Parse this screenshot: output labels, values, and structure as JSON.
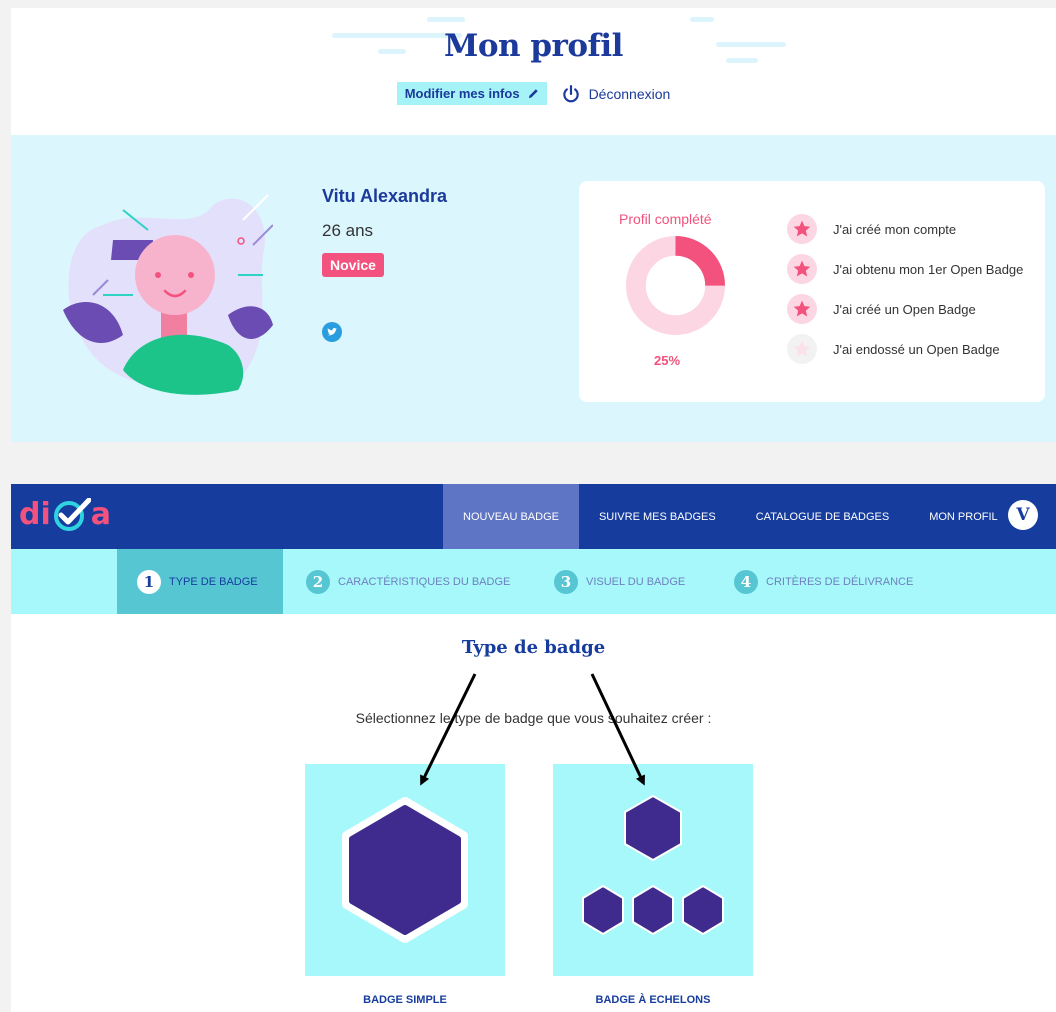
{
  "profile": {
    "title": "Mon profil",
    "edit_label": "Modifier mes infos",
    "logout_label": "Déconnexion",
    "user": {
      "name": "Vitu Alexandra",
      "age": "26 ans",
      "level": "Novice"
    },
    "progress": {
      "title": "Profil complété",
      "value": 0.25,
      "label": "25%",
      "colors": {
        "fill": "#f2527d",
        "track": "#fcd6e2"
      }
    },
    "achievements": [
      {
        "label": "J'ai créé mon compte",
        "done": true
      },
      {
        "label": "J'ai obtenu mon 1er Open Badge",
        "done": true
      },
      {
        "label": "J'ai créé un Open Badge",
        "done": true
      },
      {
        "label": "J'ai endossé un Open Badge",
        "done": false
      }
    ]
  },
  "app": {
    "logo": {
      "prefix": "di",
      "suffix": "a",
      "icon": "checkmark-circle-icon"
    },
    "nav": [
      {
        "label": "NOUVEAU BADGE",
        "active": true
      },
      {
        "label": "SUIVRE MES BADGES",
        "active": false
      },
      {
        "label": "CATALOGUE DE BADGES",
        "active": false
      },
      {
        "label": "MON PROFIL",
        "active": false
      }
    ],
    "user_initial": "V",
    "steps": [
      {
        "num": "1",
        "label": "TYPE DE BADGE",
        "active": true
      },
      {
        "num": "2",
        "label": "CARACTÉRISTIQUES DU BADGE",
        "active": false
      },
      {
        "num": "3",
        "label": "VISUEL DU BADGE",
        "active": false
      },
      {
        "num": "4",
        "label": "CRITÈRES DE DÉLIVRANCE",
        "active": false
      }
    ],
    "section_title": "Type de badge",
    "instruction": "Sélectionnez le type de badge que vous souhaitez créer :",
    "choices": [
      {
        "label": "BADGE SIMPLE"
      },
      {
        "label": "BADGE À ECHELONS"
      }
    ],
    "colors": {
      "brand": "#163c9e",
      "accent": "#f2527d",
      "light": "#a6f8fa",
      "hexagon": "#3f2a8e"
    }
  }
}
